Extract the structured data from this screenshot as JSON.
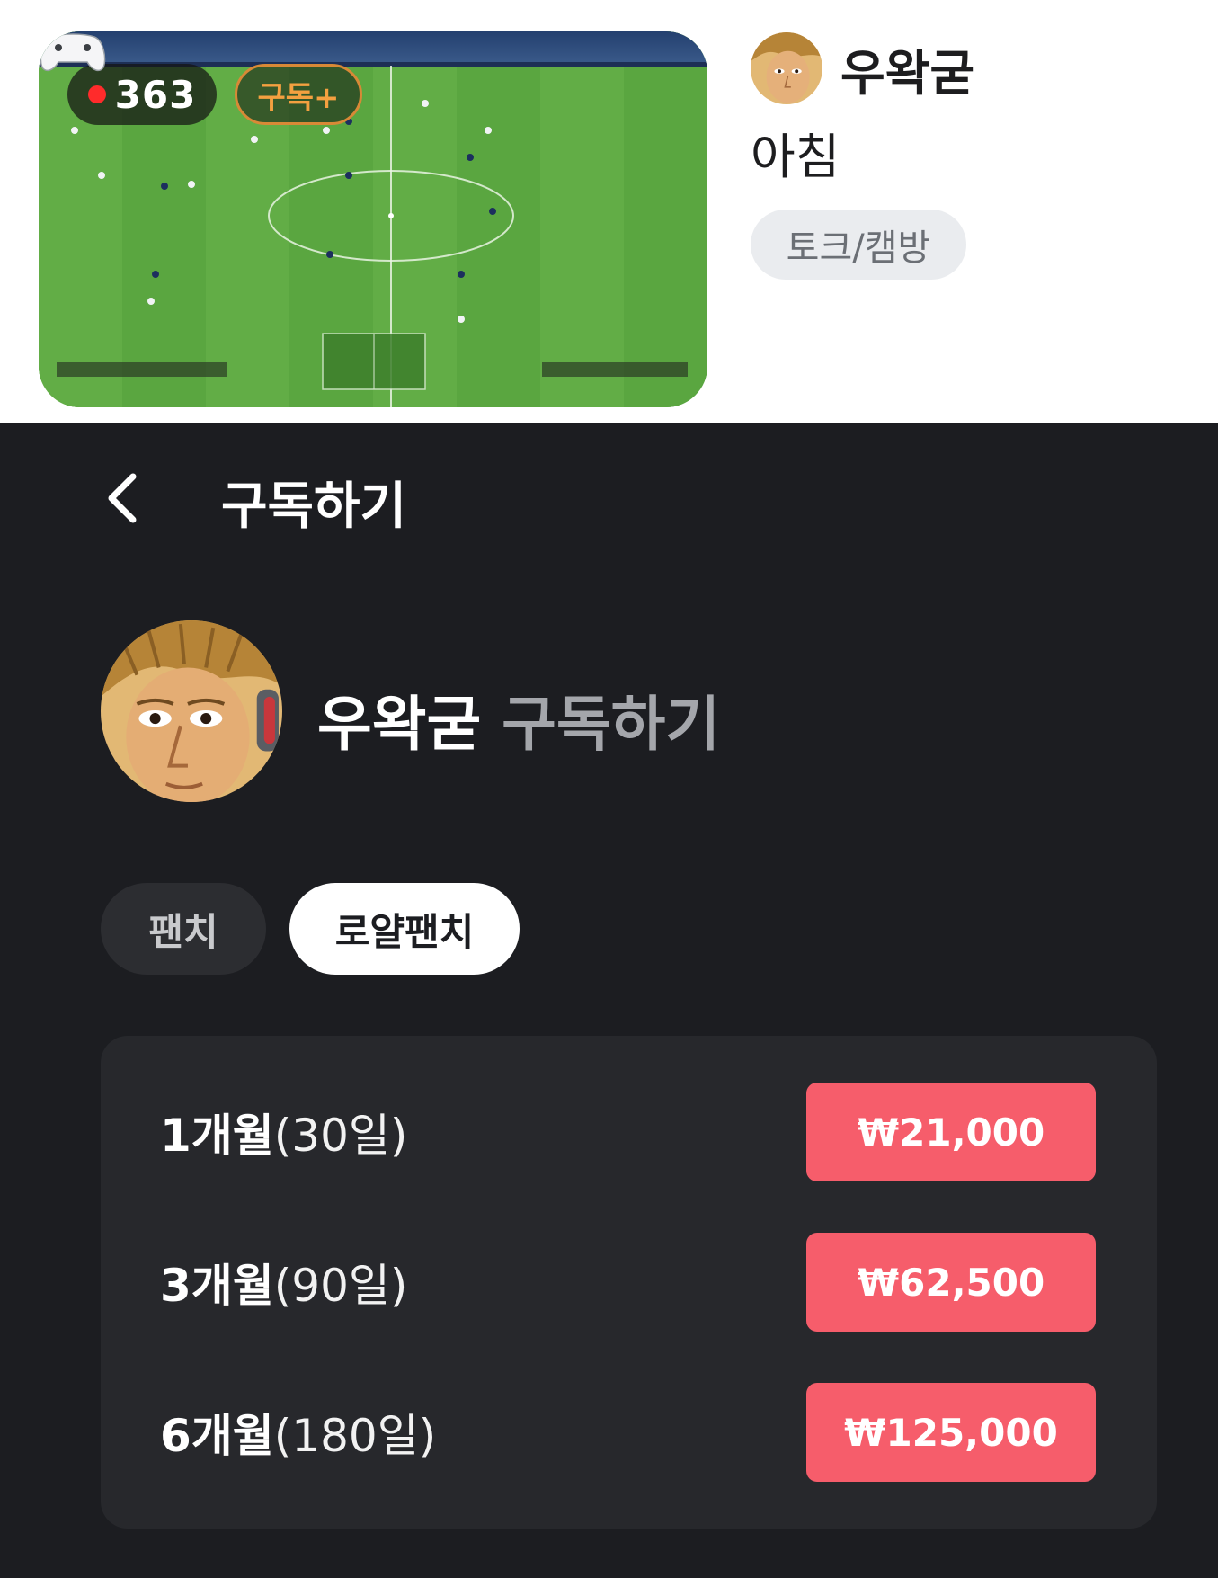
{
  "stream_card": {
    "viewer_count": "363",
    "subscribe_badge": "구독+",
    "streamer_name": "우왁굳",
    "title": "아침",
    "category": "토크/캠방",
    "colors": {
      "live_dot": "#ff2b2b",
      "subscribe_badge": "#f4a040"
    }
  },
  "subscribe_page": {
    "title": "구독하기",
    "streamer_name": "우왁굳",
    "action": "구독하기",
    "tabs": [
      {
        "label": "팬치",
        "selected": false
      },
      {
        "label": "로얄팬치",
        "selected": true
      }
    ],
    "plans": [
      {
        "months": "1개월",
        "days": "(30일)",
        "price": "₩21,000"
      },
      {
        "months": "3개월",
        "days": "(90일)",
        "price": "₩62,500"
      },
      {
        "months": "6개월",
        "days": "(180일)",
        "price": "₩125,000"
      }
    ],
    "colors": {
      "background": "#1c1d21",
      "price_button": "#f65d6b"
    }
  }
}
